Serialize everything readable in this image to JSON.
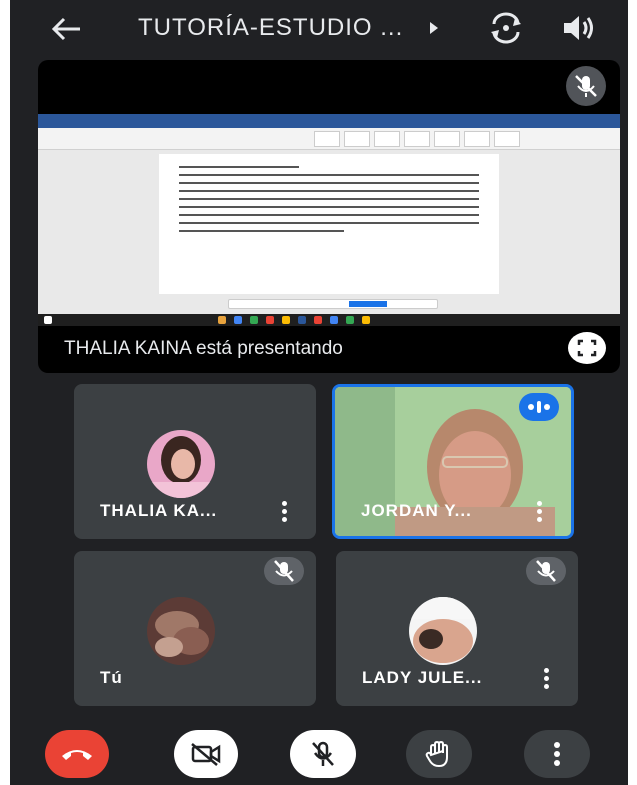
{
  "header": {
    "title": "TUTORÍA-ESTUDIO ...",
    "icons": [
      "back-arrow-icon",
      "play-triangle-icon",
      "flip-camera-icon",
      "speaker-icon"
    ]
  },
  "presentation": {
    "presenter_label": "THALIA KAINA está presentando",
    "icons": [
      "mic-off-icon",
      "fullscreen-icon"
    ]
  },
  "participants": [
    {
      "name": "THALIA KA...",
      "muted": false
    },
    {
      "name": "JORDAN Y...",
      "muted": false,
      "speaking": true
    },
    {
      "name": "Tú",
      "muted": true
    },
    {
      "name": "LADY JULE...",
      "muted": true
    }
  ],
  "controls": {
    "icons": [
      "end-call-icon",
      "camera-off-icon",
      "mic-off-icon",
      "raise-hand-icon",
      "more-vert-icon"
    ]
  },
  "colors": {
    "background": "#202124",
    "tile": "#3c4043",
    "end_call": "#ea4335",
    "active_speaker_border": "#1a73e8"
  }
}
